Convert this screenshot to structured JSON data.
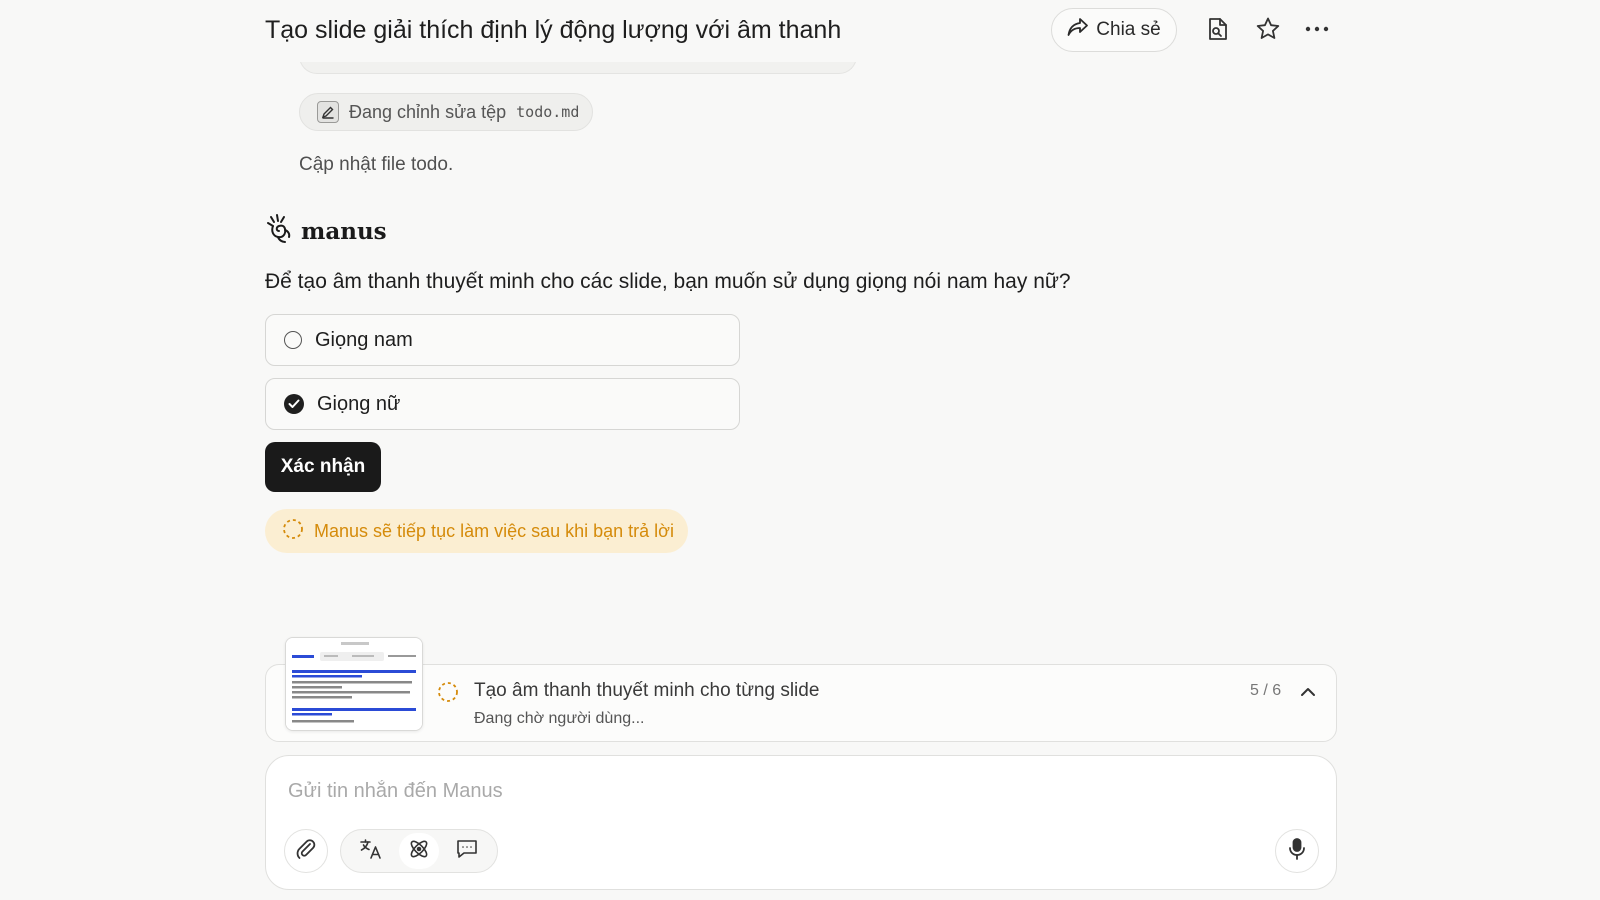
{
  "header": {
    "title": "Tạo slide giải thích định lý động lượng với âm thanh",
    "share_label": "Chia sẻ",
    "icons": [
      "document-search-icon",
      "star-icon",
      "more-icon"
    ]
  },
  "activity": {
    "file_chip_label": "Đang chỉnh sửa tệp",
    "file_chip_file": "todo.md",
    "update_text": "Cập nhật file todo."
  },
  "assistant": {
    "name": "manus",
    "question": "Để tạo âm thanh thuyết minh cho các slide, bạn muốn sử dụng giọng nói nam hay nữ?",
    "options": [
      {
        "label": "Giọng nam",
        "selected": false
      },
      {
        "label": "Giọng nữ",
        "selected": true
      }
    ],
    "confirm_label": "Xác nhận",
    "waiting_notice": "Manus sẽ tiếp tục làm việc sau khi bạn trả lời"
  },
  "task": {
    "title": "Tạo âm thanh thuyết minh cho từng slide",
    "status": "Đang chờ người dùng...",
    "progress": "5 / 6"
  },
  "composer": {
    "placeholder": "Gửi tin nhắn đến Manus"
  },
  "colors": {
    "accent_dark": "#1a1a1a",
    "waiting_bg": "#fbeed2",
    "waiting_text": "#d58b0b",
    "background": "#f8f8f7"
  }
}
